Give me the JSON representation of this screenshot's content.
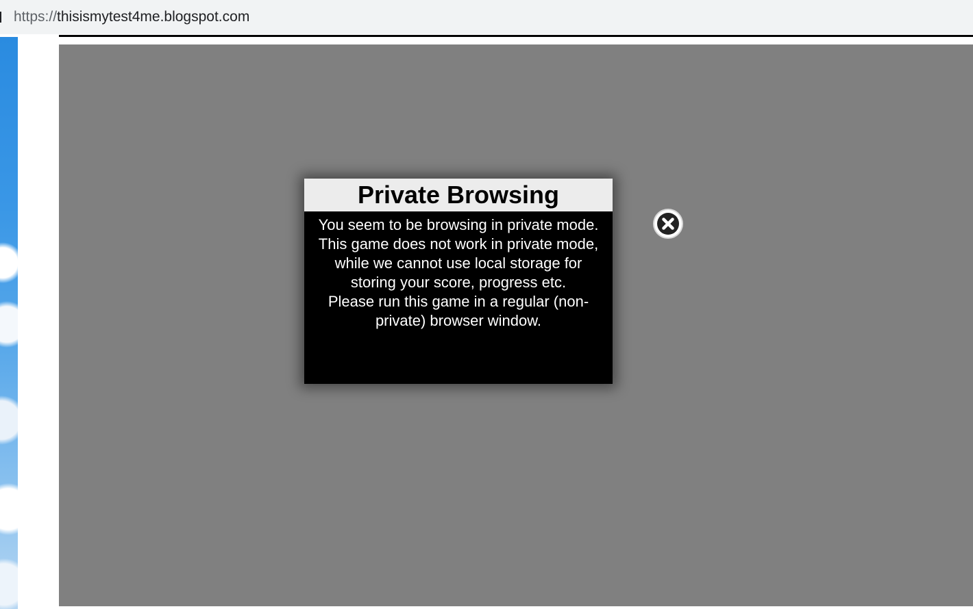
{
  "browser": {
    "url_scheme": "https://",
    "url_host": "thisismytest4me.blogspot.com"
  },
  "dialog": {
    "title": "Private Browsing",
    "message_line1": "You seem to be browsing in private mode. This game does not work in private mode, while we cannot use local storage for storing your score, progress etc.",
    "message_line2": "Please run this game in a regular (non-private) browser window.",
    "close_icon": "close-circle-icon"
  },
  "colors": {
    "game_background": "#808080",
    "dialog_body": "#000000",
    "dialog_header": "#ececec",
    "dialog_text": "#ffffff"
  }
}
